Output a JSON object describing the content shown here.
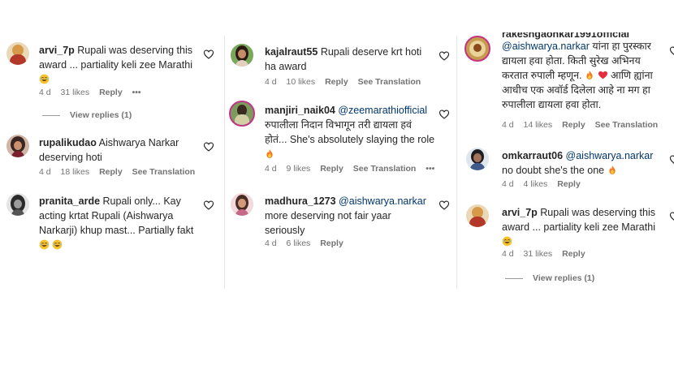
{
  "col1": {
    "c1": {
      "user": "arvi_7p",
      "text": "Rupali was deserving this award ... partiality keli zee Marathi",
      "age": "4 d",
      "likes": "31 likes",
      "reply": "Reply",
      "more": "•••",
      "view_replies": "View replies (1)"
    },
    "c2": {
      "user": "rupalikudao",
      "text": "Aishwarya Narkar deserving hoti",
      "age": "4 d",
      "likes": "18 likes",
      "reply": "Reply",
      "see_translation": "See Translation"
    },
    "c3": {
      "user": "pranita_arde",
      "text": "Rupali only... Kay acting krtat Rupali (Aishwarya Narkarji) khup mast... Partially fakt"
    }
  },
  "col2": {
    "c1": {
      "user": "kajalraut55",
      "text": "Rupali deserve krt hoti ha award",
      "age": "4 d",
      "likes": "10 likes",
      "reply": "Reply",
      "see_translation": "See Translation"
    },
    "c2": {
      "user": "manjiri_naik04",
      "mention": "@zeemarathiofficial",
      "text": "रुपालीला निदान विभागून तरी द्यायला हवं होतं... She's absolutely slaying the role",
      "age": "4 d",
      "likes": "9 likes",
      "reply": "Reply",
      "see_translation": "See Translation",
      "more": "•••"
    },
    "c3": {
      "user": "madhura_1273",
      "mention": "@aishwarya.narkar",
      "text": "more deserving not fair yaar seriously",
      "age": "4 d",
      "likes": "6 likes",
      "reply": "Reply"
    }
  },
  "col3": {
    "c1": {
      "user": "rakeshgaonkar1991official",
      "mention": "@aishwarya.narkar",
      "text1": "यांना हा पुरस्कार द्यायला हवा होता. किती सुरेख अभिनय करतात रुपाली म्हणून.",
      "text2": "आणि ह्यांना आधीच एक अवॉर्ड दिलेला आहे ना मग हा रुपालीला द्यायला हवा होता.",
      "age": "4 d",
      "likes": "14 likes",
      "reply": "Reply",
      "see_translation": "See Translation"
    },
    "c2": {
      "user": "omkarraut06",
      "mention": "@aishwarya.narkar",
      "text": "no doubt she's the one",
      "age": "4 d",
      "likes": "4 likes",
      "reply": "Reply"
    },
    "c3": {
      "user": "arvi_7p",
      "text": "Rupali was deserving this award ... partiality keli zee Marathi",
      "age": "4 d",
      "likes": "31 likes",
      "reply": "Reply",
      "view_replies": "View replies (1)"
    }
  },
  "colors": {
    "mention": "#00376b",
    "meta": "#737373",
    "text": "#262626",
    "heart_red": "#ed4956",
    "fire": "#f77b1e"
  },
  "icons": [
    "heart-outline-icon",
    "laughing-emoji-icon",
    "fire-emoji-icon",
    "red-heart-emoji-icon"
  ]
}
